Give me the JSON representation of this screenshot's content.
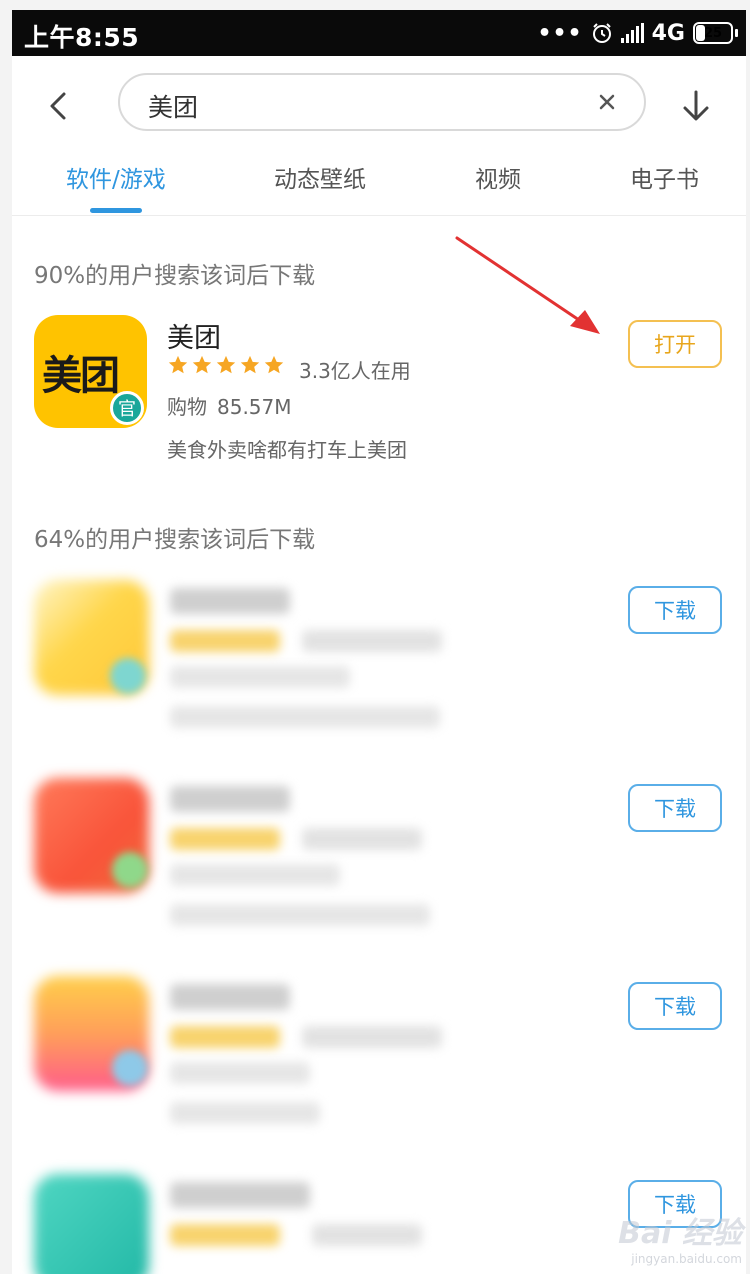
{
  "status_bar": {
    "time": "上午8:55",
    "dots": "•••",
    "network": "4G",
    "battery": "25"
  },
  "search": {
    "query": "美团"
  },
  "tabs": [
    {
      "label": "软件/游戏",
      "active": true
    },
    {
      "label": "动态壁纸",
      "active": false
    },
    {
      "label": "视频",
      "active": false
    },
    {
      "label": "电子书",
      "active": false
    }
  ],
  "section_1": {
    "label": "90%的用户搜索该词后下载",
    "app": {
      "icon_text": "美团",
      "badge": "官",
      "name": "美团",
      "rating_stars": 5,
      "users": "3.3亿人在用",
      "category": "购物",
      "size": "85.57M",
      "description": "美食外卖啥都有打车上美团",
      "button": "打开"
    }
  },
  "section_2": {
    "label": "64%的用户搜索该词后下载",
    "button_label": "下载"
  },
  "colors": {
    "accent": "#2f96df",
    "open_button": "#e8a61c",
    "meituan_yellow": "#ffc300",
    "star": "#f6a623"
  },
  "watermark": {
    "main": "Bai 经验",
    "sub": "jingyan.baidu.com"
  }
}
